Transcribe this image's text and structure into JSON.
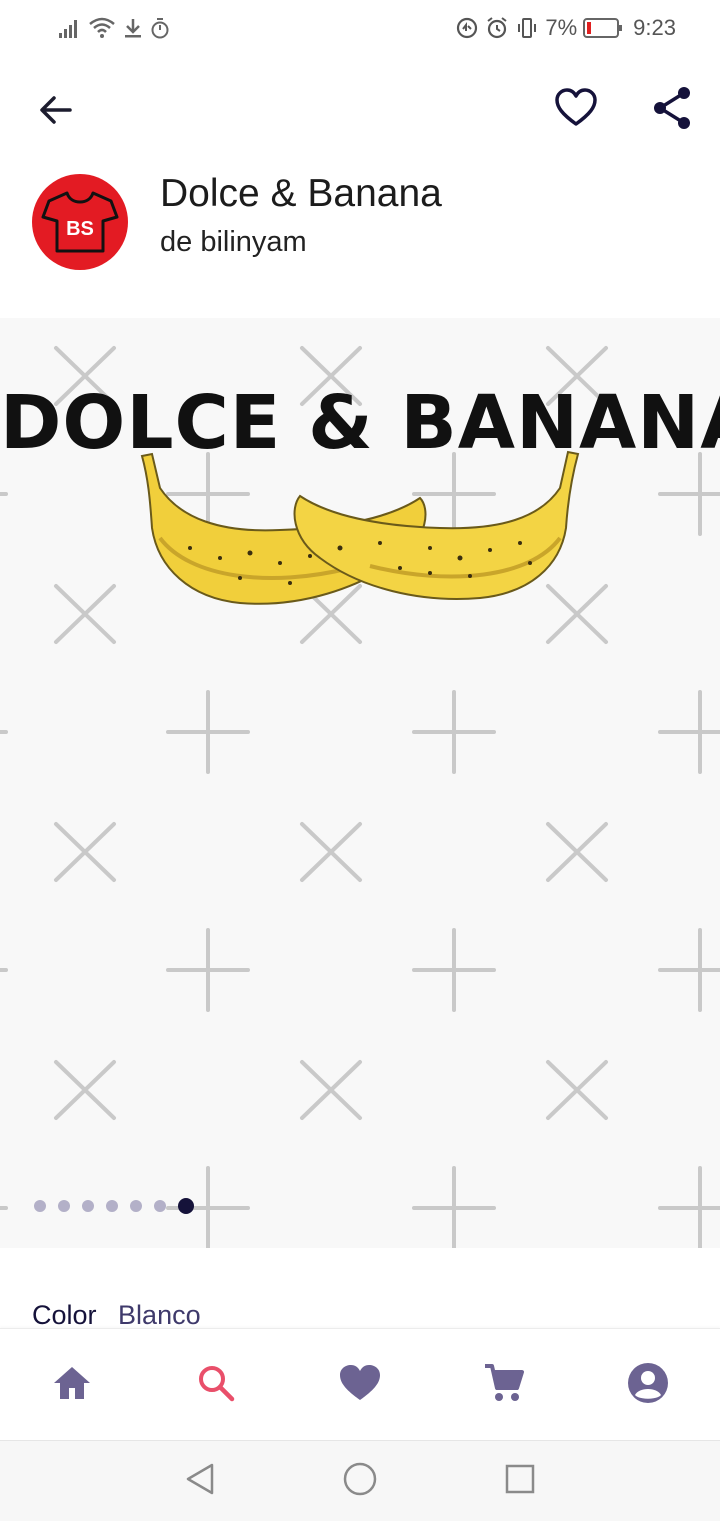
{
  "status_bar": {
    "battery_percent": "7%",
    "time": "9:23",
    "icons_left": [
      "signal-icon",
      "wifi-icon",
      "download-icon",
      "timer-icon"
    ],
    "icons_right": [
      "data-saver-icon",
      "alarm-icon",
      "vibrate-icon",
      "battery-icon"
    ]
  },
  "top_bar": {
    "icons": [
      "back-arrow-icon",
      "heart-outline-icon",
      "share-icon"
    ]
  },
  "product": {
    "title": "Dolce & Banana",
    "author": "de bilinyam",
    "shop_logo_text": "BS"
  },
  "gallery": {
    "design_text": "DOLCE & BANANA",
    "image_count": 7,
    "active_index": 6
  },
  "details": {
    "color_label": "Color",
    "color_value": "Blanco"
  },
  "bottom_nav": {
    "items": [
      "home-icon",
      "search-icon",
      "favorites-heart-icon",
      "cart-icon",
      "account-icon"
    ],
    "active_item": "search-icon"
  },
  "colors": {
    "accent": "#e94f6a",
    "nav_icon": "#6c6392",
    "primary_dark": "#15123a",
    "shop_logo_bg": "#e31b23"
  }
}
